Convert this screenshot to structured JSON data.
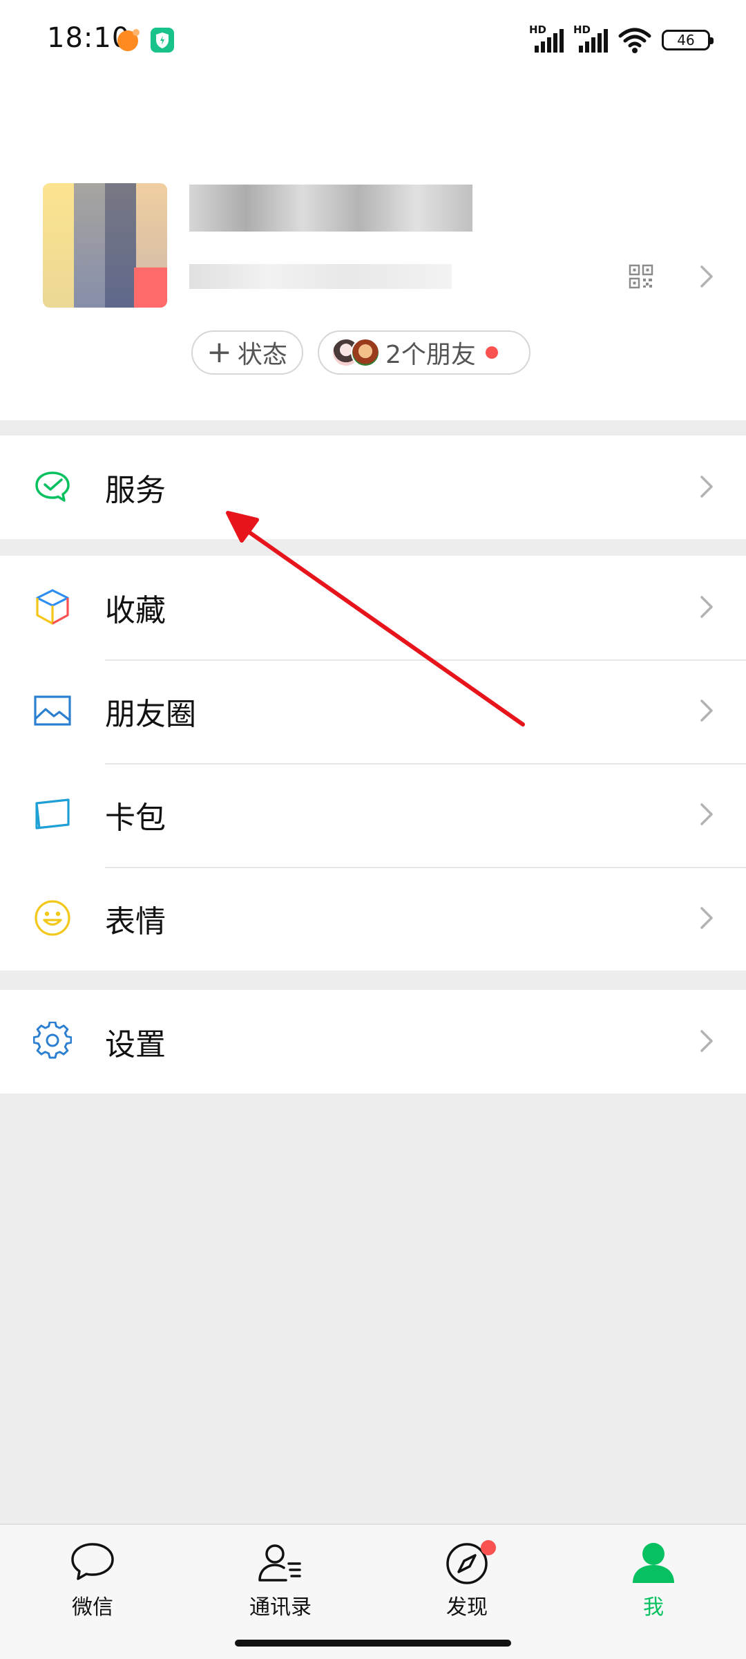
{
  "status_bar": {
    "time": "18:10",
    "network_1": "HD",
    "network_2": "HD",
    "battery": "46"
  },
  "profile": {
    "status_pill_plus": "+",
    "status_pill_label": "状态",
    "friends_pill_label": "2个朋友"
  },
  "menu": {
    "service": "服务",
    "favorites": "收藏",
    "moments": "朋友圈",
    "cards": "卡包",
    "stickers": "表情",
    "settings": "设置"
  },
  "tabbar": {
    "chats": "微信",
    "contacts": "通讯录",
    "discover": "发现",
    "me": "我"
  },
  "colors": {
    "wechat_green": "#07c160",
    "badge_red": "#fa5151",
    "annotation_red": "#e8141b",
    "page_bg": "#ededed"
  }
}
